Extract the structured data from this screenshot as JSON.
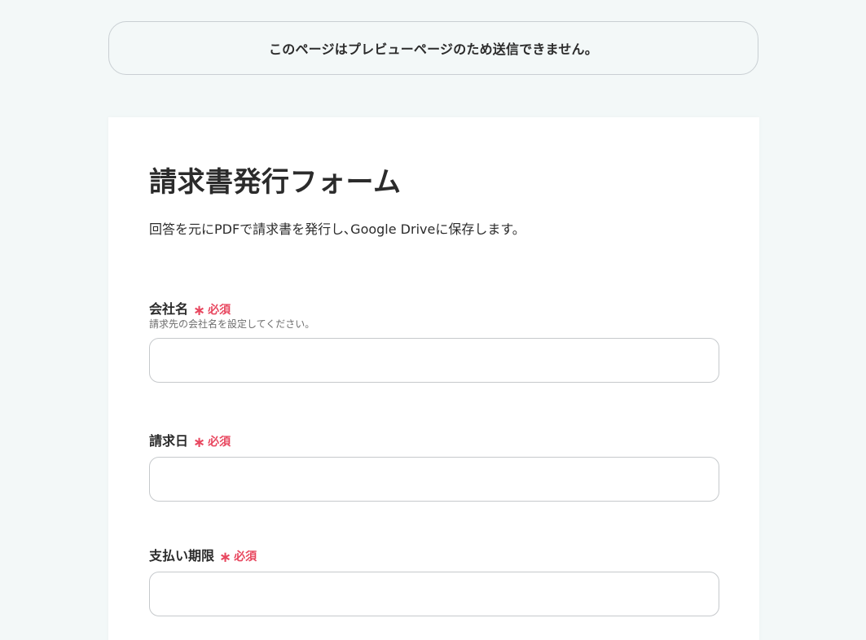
{
  "notice": {
    "text": "このページはプレビューページのため送信できません。"
  },
  "form": {
    "title": "請求書発行フォーム",
    "description": "回答を元にPDFで請求書を発行し､Google Driveに保存します。",
    "required_star": "∗",
    "required_text": "必須",
    "fields": [
      {
        "label": "会社名",
        "help": "請求先の会社名を設定してください。",
        "value": "",
        "placeholder": ""
      },
      {
        "label": "請求日",
        "help": "",
        "value": "",
        "placeholder": ""
      },
      {
        "label": "支払い期限",
        "help": "",
        "value": "",
        "placeholder": ""
      }
    ]
  },
  "colors": {
    "background": "#f3f8f8",
    "card": "#ffffff",
    "required": "#e8475f",
    "border": "#c6c9cc"
  }
}
